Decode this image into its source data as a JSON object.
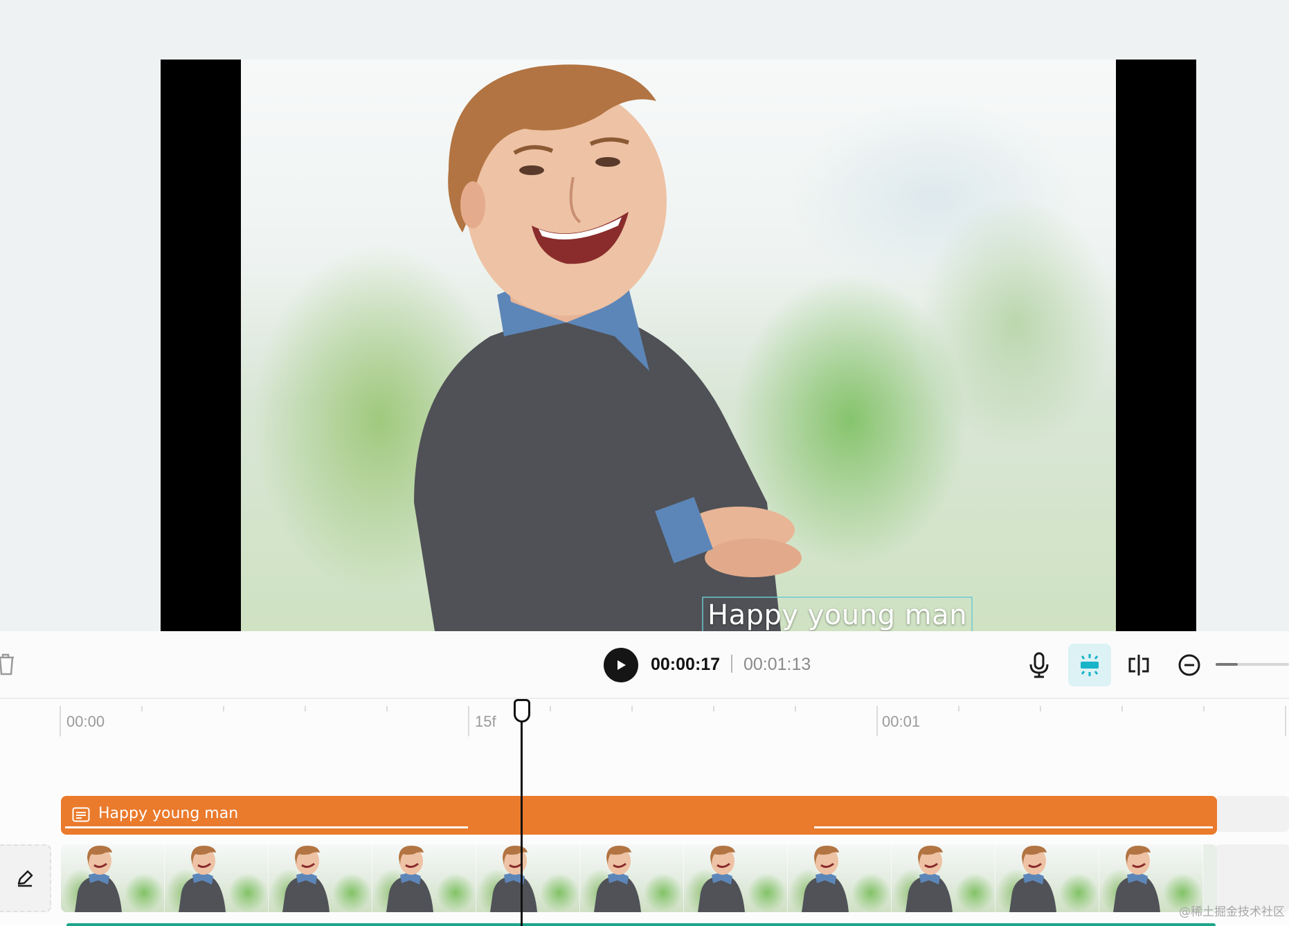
{
  "preview": {
    "caption": "Happy young man"
  },
  "controls": {
    "current_time": "00:00:17",
    "total_time": "00:01:13",
    "zoom_level": 0.3
  },
  "timeline": {
    "ruler_labels": [
      "00:00",
      "15f",
      "00:01"
    ],
    "text_clip_label": "Happy young man",
    "video_thumbnail_count": 11
  },
  "watermark": "@稀土掘金技术社区",
  "colors": {
    "accent": "#1ea58a",
    "text_clip": "#ea7a2c",
    "snap_active_bg": "#dcf2f5",
    "snap_icon": "#17b3c7"
  },
  "icons": [
    "trash-icon",
    "play-icon",
    "microphone-icon",
    "magnet-snap-icon",
    "split-icon",
    "zoom-out-icon",
    "text-clip-icon",
    "edit-pencil-icon"
  ]
}
